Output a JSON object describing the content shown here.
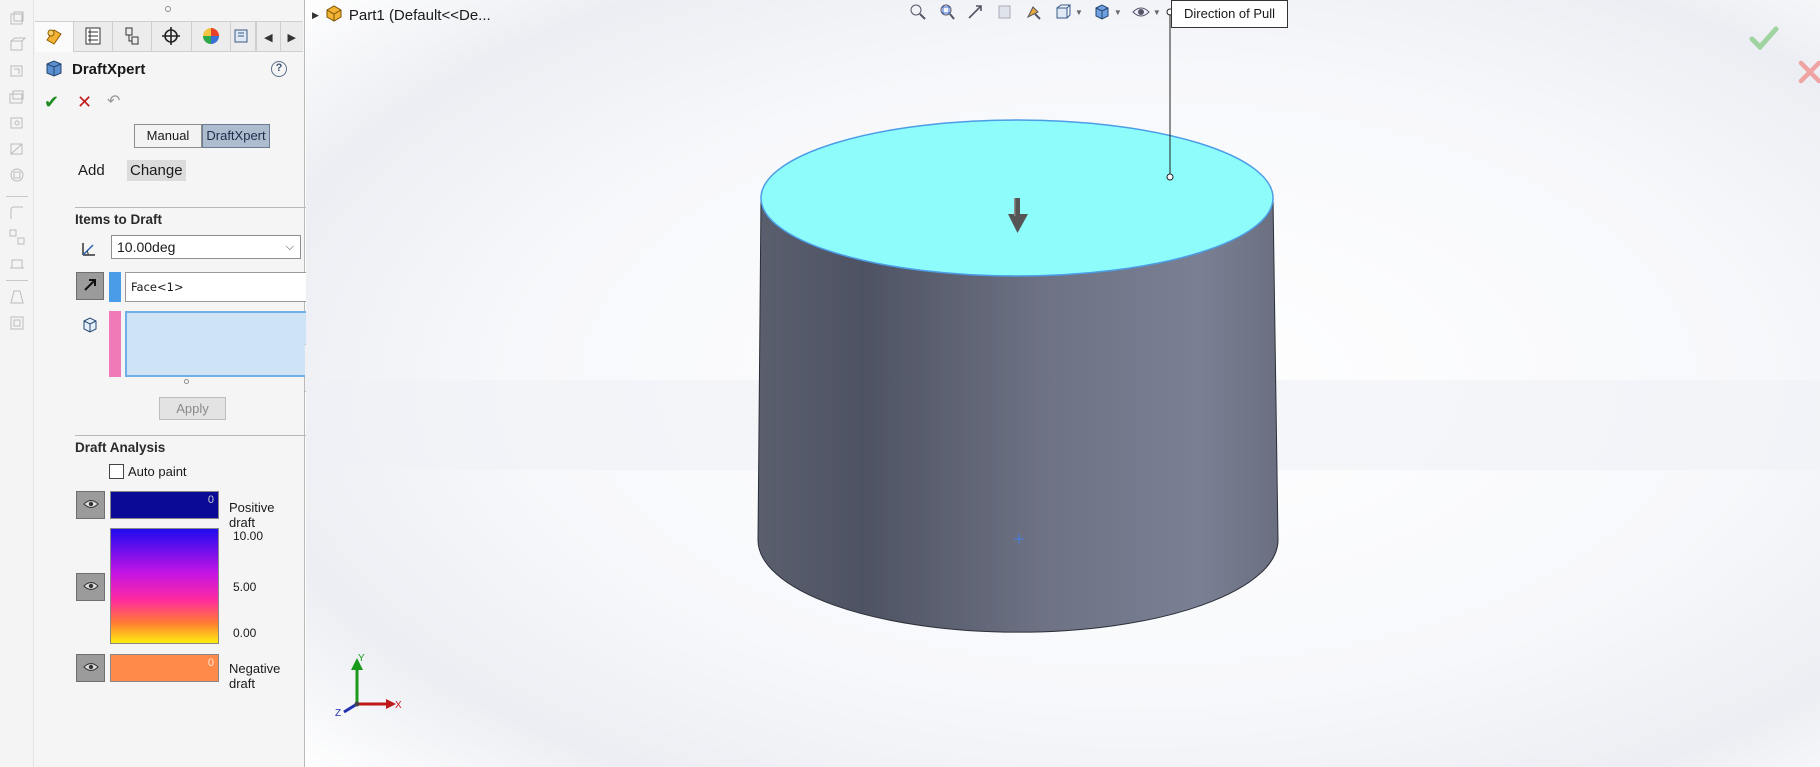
{
  "property_manager": {
    "title": "DraftXpert",
    "help_glyph": "?",
    "mode_buttons": {
      "manual": "Manual",
      "draftxpert": "DraftXpert",
      "active": "draftxpert"
    },
    "sub_tabs": {
      "add": "Add",
      "change": "Change",
      "active": "change"
    },
    "items_to_draft": {
      "title": "Items to Draft",
      "draft_angle": "10.00deg",
      "selected_face": "Face<1>",
      "apply_label": "Apply"
    },
    "draft_analysis": {
      "title": "Draft Analysis",
      "auto_paint_label": "Auto paint",
      "auto_paint_checked": false,
      "positive": {
        "label": "Positive draft",
        "count": "0",
        "color": "#0a0a96"
      },
      "scale": {
        "max": "10.00",
        "mid": "5.00",
        "min": "0.00"
      },
      "negative": {
        "label": "Negative draft",
        "count": "0",
        "color": "#ff8a4a"
      }
    },
    "tab_icons": [
      "feature-manager-icon",
      "property-manager-icon",
      "configuration-manager-icon",
      "dimxpert-icon",
      "display-manager-icon",
      "cam-icon"
    ]
  },
  "graphics": {
    "tree_item": "Part1  (Default<<De...",
    "direction_callout": "Direction of Pull",
    "face_highlight_color": "#8ffcfc",
    "body_color": "#6b7185",
    "triad_labels": {
      "x": "X",
      "y": "Y",
      "z": "Z"
    }
  },
  "heads_up_toolbar": [
    "zoom-to-fit-icon",
    "zoom-to-area-icon",
    "previous-view-icon",
    "section-view-icon",
    "dynamic-annotation-icon",
    "view-orientation-icon",
    "display-style-icon",
    "hide-show-items-icon",
    "edit-appearance-icon"
  ],
  "confirmation_corner": {
    "ok": "ok-check-icon",
    "cancel": "cancel-x-icon"
  }
}
